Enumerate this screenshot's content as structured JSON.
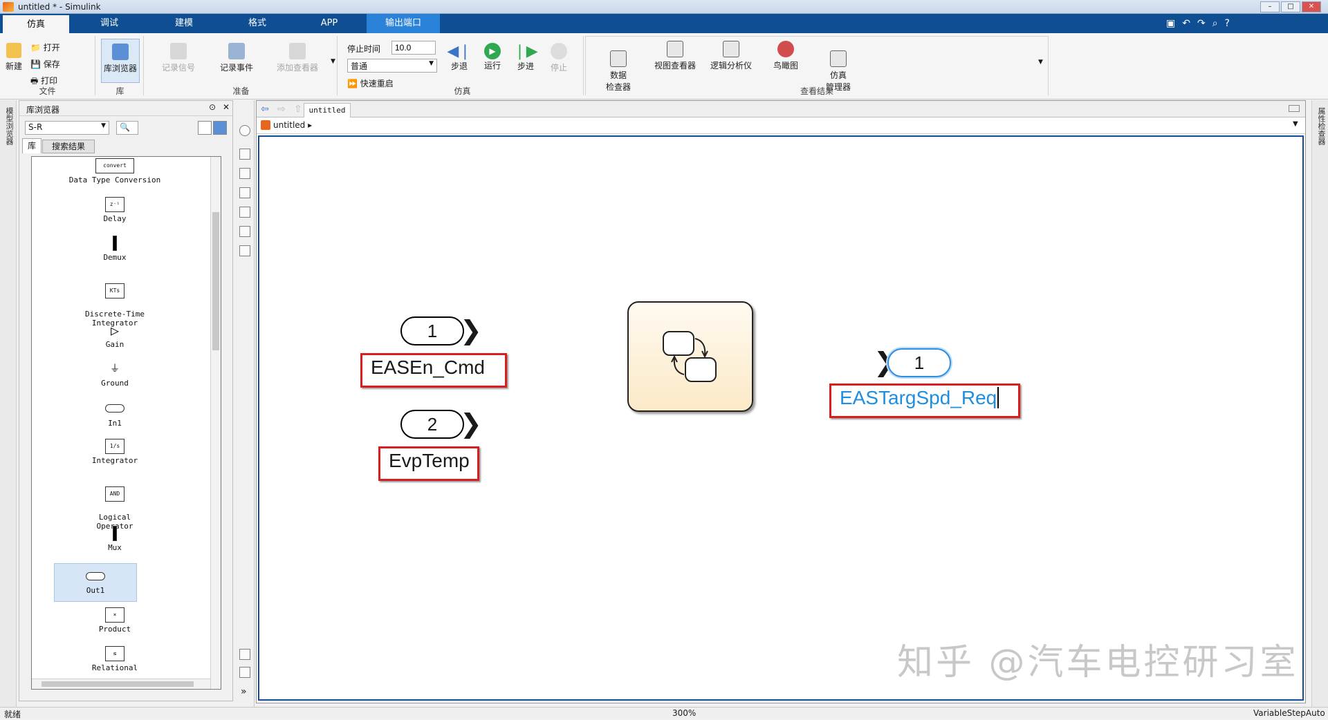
{
  "window": {
    "title": "untitled * - Simulink"
  },
  "menu": {
    "tabs": [
      "仿真",
      "调试",
      "建模",
      "格式",
      "APP",
      "输出端口"
    ]
  },
  "ribbon": {
    "file": {
      "new": "新建",
      "open": "打开",
      "save": "保存",
      "print": "打印",
      "group": "文件"
    },
    "library": {
      "browser": "库浏览器",
      "group": "库"
    },
    "prepare": {
      "log_signal": "记录信号",
      "log_event": "记录事件",
      "add_viewer": "添加查看器",
      "group": "准备"
    },
    "simulate": {
      "stop_time_label": "停止时间",
      "stop_time_value": "10.0",
      "mode": "普通",
      "fast_restart": "快速重启",
      "step_back": "步退",
      "run": "运行",
      "step_forward": "步进",
      "stop": "停止",
      "group": "仿真"
    },
    "review": {
      "data_inspector": "数据\n检查器",
      "viewer": "视图查看器",
      "logic_analyzer": "逻辑分析仪",
      "birdseye": "鸟瞰图",
      "sim_manager": "仿真\n管理器",
      "group": "查看结果"
    }
  },
  "left_sidebar": {
    "vtab": "模型浏览器"
  },
  "right_sidebar": {
    "vtab": "属性检查器"
  },
  "library_panel": {
    "title": "库浏览器",
    "filter": "S-R",
    "tabs": [
      "库",
      "搜索结果"
    ],
    "blocks": [
      "Data Type Conversion",
      "Delay",
      "Demux",
      "Discrete-Time\nIntegrator",
      "Gain",
      "Ground",
      "In1",
      "Integrator",
      "Logical\nOperator",
      "Mux",
      "Out1",
      "Product",
      "Relational"
    ],
    "convert_label": "convert"
  },
  "editor": {
    "tab": "untitled",
    "breadcrumb": "untitled"
  },
  "canvas": {
    "inport1": {
      "number": "1",
      "name": "EASEn_Cmd"
    },
    "inport2": {
      "number": "2",
      "name": "EvpTemp"
    },
    "outport1": {
      "number": "1",
      "name": "EASTargSpd_Req"
    }
  },
  "status": {
    "left": "就绪",
    "zoom": "300%",
    "solver": "VariableStepAuto"
  },
  "watermark": "知乎 @汽车电控研习室"
}
